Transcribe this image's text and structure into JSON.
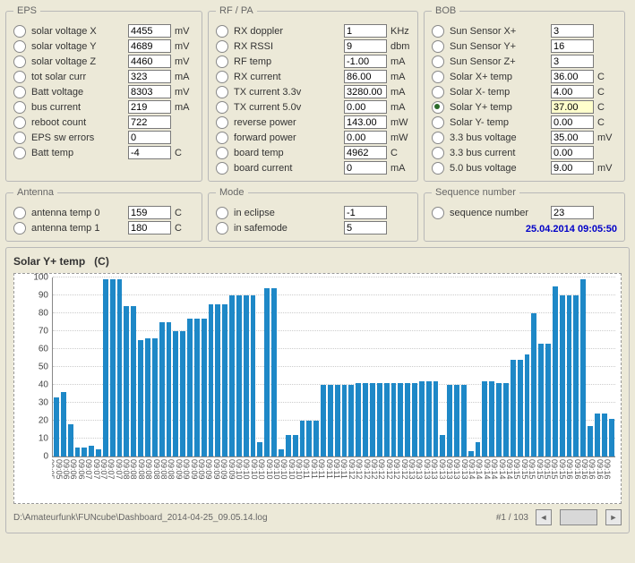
{
  "eps": {
    "legend": "EPS",
    "items": [
      {
        "label": "solar voltage X",
        "value": "4455",
        "unit": "mV"
      },
      {
        "label": "solar voltage Y",
        "value": "4689",
        "unit": "mV"
      },
      {
        "label": "solar voltage Z",
        "value": "4460",
        "unit": "mV"
      },
      {
        "label": "tot solar curr",
        "value": "323",
        "unit": "mA"
      },
      {
        "label": "Batt voltage",
        "value": "8303",
        "unit": "mV"
      },
      {
        "label": "bus current",
        "value": "219",
        "unit": "mA"
      },
      {
        "label": "reboot count",
        "value": "722",
        "unit": ""
      },
      {
        "label": "EPS sw errors",
        "value": "0",
        "unit": ""
      },
      {
        "label": "Batt temp",
        "value": "-4",
        "unit": "C"
      }
    ]
  },
  "rf": {
    "legend": "RF / PA",
    "items": [
      {
        "label": "RX doppler",
        "value": "1",
        "unit": "KHz"
      },
      {
        "label": "RX RSSI",
        "value": "9",
        "unit": "dbm"
      },
      {
        "label": "RF temp",
        "value": "-1.00",
        "unit": "mA"
      },
      {
        "label": "RX current",
        "value": "86.00",
        "unit": "mA"
      },
      {
        "label": "TX current 3.3v",
        "value": "3280.00",
        "unit": "mA"
      },
      {
        "label": "TX current 5.0v",
        "value": "0.00",
        "unit": "mA"
      },
      {
        "label": "reverse power",
        "value": "143.00",
        "unit": "mW"
      },
      {
        "label": "forward power",
        "value": "0.00",
        "unit": "mW"
      },
      {
        "label": "board temp",
        "value": "4962",
        "unit": "C"
      },
      {
        "label": "board current",
        "value": "0",
        "unit": "mA"
      }
    ]
  },
  "bob": {
    "legend": "BOB",
    "selected": 5,
    "items": [
      {
        "label": "Sun Sensor X+",
        "value": "3",
        "unit": ""
      },
      {
        "label": "Sun Sensor Y+",
        "value": "16",
        "unit": ""
      },
      {
        "label": "Sun Sensor Z+",
        "value": "3",
        "unit": ""
      },
      {
        "label": "Solar X+ temp",
        "value": "36.00",
        "unit": "C"
      },
      {
        "label": "Solar X- temp",
        "value": "4.00",
        "unit": "C"
      },
      {
        "label": "Solar Y+ temp",
        "value": "37.00",
        "unit": "C"
      },
      {
        "label": "Solar Y- temp",
        "value": "0.00",
        "unit": "C"
      },
      {
        "label": "3.3 bus voltage",
        "value": "35.00",
        "unit": "mV"
      },
      {
        "label": "3.3 bus current",
        "value": "0.00",
        "unit": ""
      },
      {
        "label": "5.0 bus voltage",
        "value": "9.00",
        "unit": "mV"
      }
    ]
  },
  "antenna": {
    "legend": "Antenna",
    "items": [
      {
        "label": "antenna temp 0",
        "value": "159",
        "unit": "C"
      },
      {
        "label": "antenna temp 1",
        "value": "180",
        "unit": "C"
      }
    ]
  },
  "mode": {
    "legend": "Mode",
    "items": [
      {
        "label": "in eclipse",
        "value": "-1",
        "unit": ""
      },
      {
        "label": "in safemode",
        "value": "5",
        "unit": ""
      }
    ]
  },
  "seq": {
    "legend": "Sequence number",
    "items": [
      {
        "label": "sequence number",
        "value": "23",
        "unit": ""
      }
    ],
    "timestamp": "25.04.2014 09:05:50"
  },
  "chart": {
    "title_main": "Solar Y+ temp",
    "title_unit": "(C)"
  },
  "footer": {
    "path": "D:\\Amateurfunk\\FUNcube\\Dashboard_2014-04-25_09.05.14.log",
    "page": "#1 / 103"
  },
  "chart_data": {
    "type": "bar",
    "title": "Solar Y+ temp (C)",
    "ylabel": "",
    "xlabel": "",
    "ylim": [
      0,
      100
    ],
    "yticks": [
      0,
      10,
      20,
      30,
      40,
      50,
      60,
      70,
      80,
      90,
      100
    ],
    "categories": [
      "09:05",
      "09:05",
      "09:06",
      "09:06",
      "09:06",
      "09:07",
      "09:07",
      "09:07",
      "09:07",
      "09:07",
      "09:08",
      "09:08",
      "09:08",
      "09:08",
      "09:08",
      "09:08",
      "09:08",
      "09:09",
      "09:09",
      "09:09",
      "09:09",
      "09:09",
      "09:09",
      "09:09",
      "09:09",
      "09:10",
      "09:10",
      "09:10",
      "09:10",
      "09:10",
      "09:10",
      "09:10",
      "09:10",
      "09:10",
      "09:11",
      "09:11",
      "09:11",
      "09:11",
      "09:11",
      "09:11",
      "09:12",
      "09:12",
      "09:12",
      "09:12",
      "09:12",
      "09:12",
      "09:12",
      "09:12",
      "09:13",
      "09:13",
      "09:13",
      "09:13",
      "09:13",
      "09:13",
      "09:13",
      "09:13",
      "09:14",
      "09:14",
      "09:14",
      "09:14",
      "09:14",
      "09:14",
      "09:15",
      "09:15",
      "09:15",
      "09:15",
      "09:15",
      "09:15",
      "09:15",
      "09:16",
      "09:16",
      "09:16",
      "09:16",
      "09:16",
      "09:16"
    ],
    "values": [
      33,
      36,
      18,
      5,
      5,
      6,
      4,
      99,
      99,
      99,
      84,
      84,
      65,
      66,
      66,
      75,
      75,
      70,
      70,
      77,
      77,
      77,
      85,
      85,
      85,
      90,
      90,
      90,
      90,
      8,
      94,
      94,
      4,
      12,
      12,
      20,
      20,
      20,
      40,
      40,
      40,
      40,
      40,
      41,
      41,
      41,
      41,
      41,
      41,
      41,
      41,
      41,
      42,
      42,
      42,
      12,
      40,
      40,
      40,
      3,
      8,
      42,
      42,
      41,
      41,
      54,
      54,
      57,
      80,
      63,
      63,
      95,
      90,
      90,
      90,
      99,
      17,
      24,
      24,
      21
    ]
  }
}
